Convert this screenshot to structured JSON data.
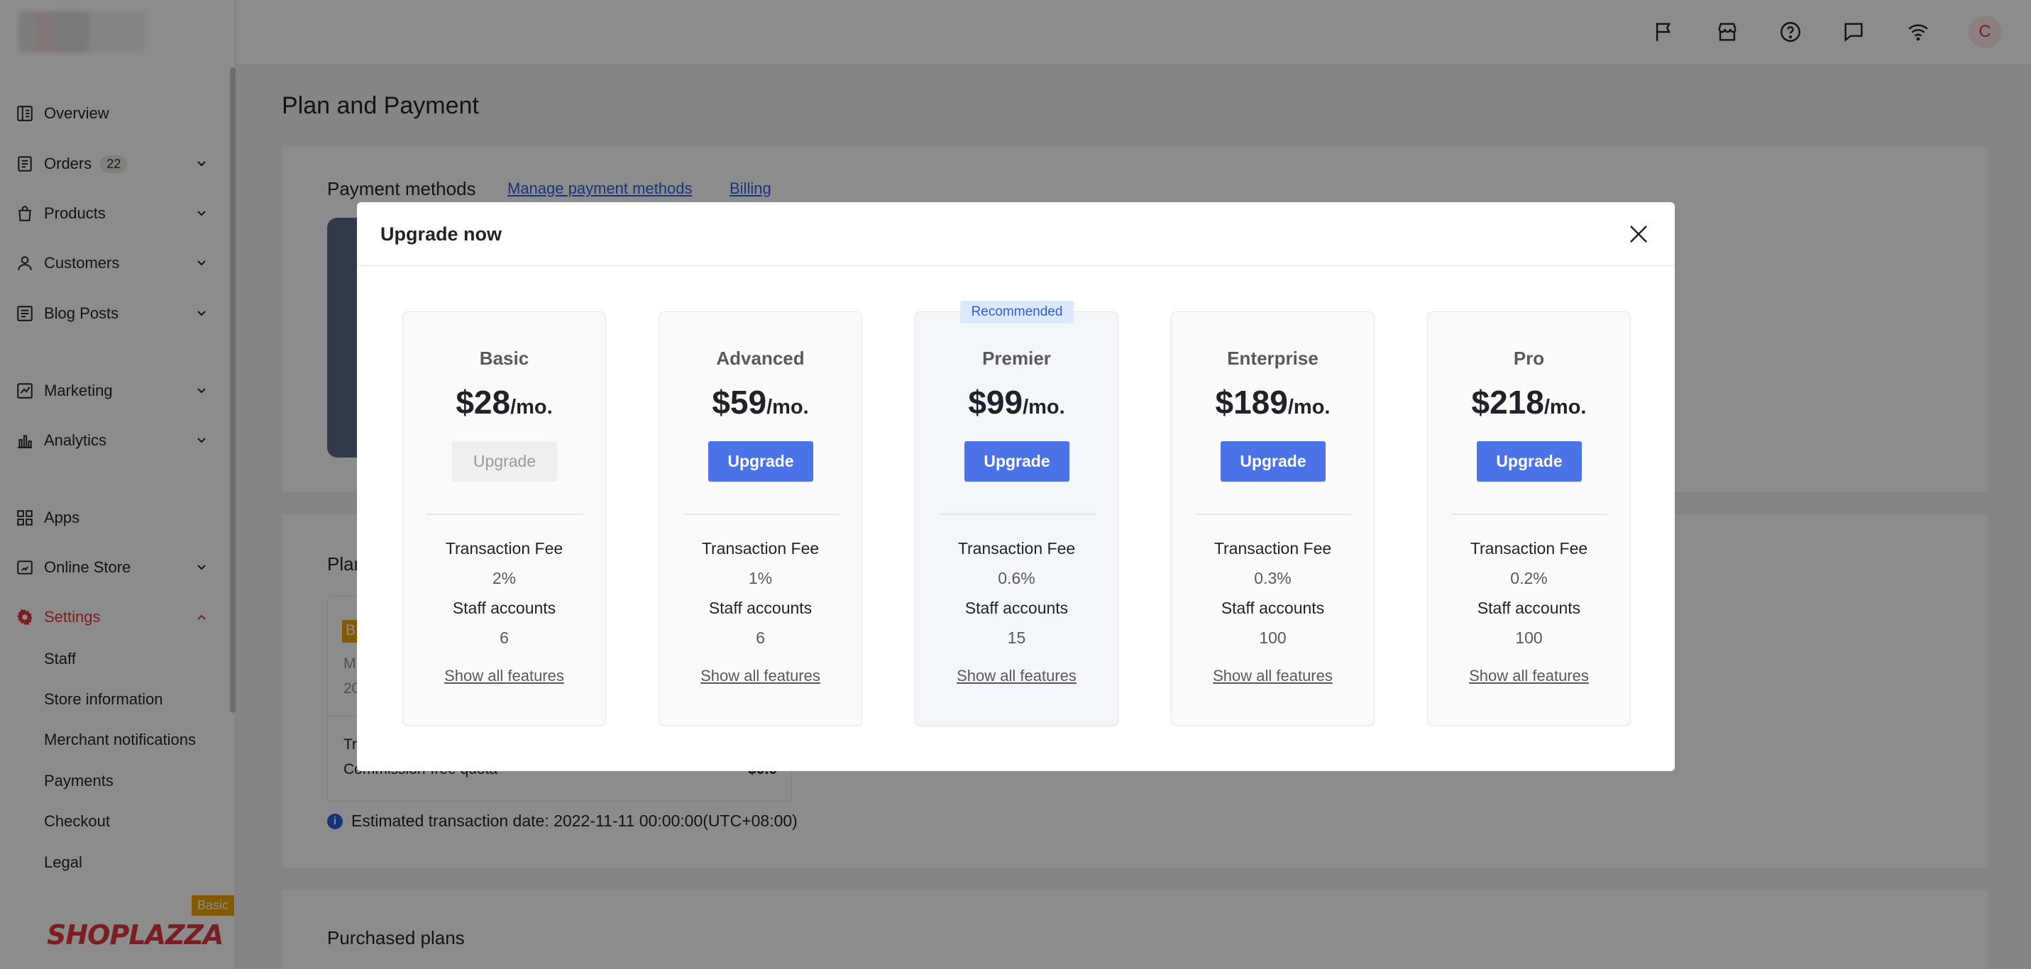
{
  "sidebar": {
    "items": [
      {
        "label": "Overview",
        "icon": "overview-icon"
      },
      {
        "label": "Orders",
        "icon": "orders-icon",
        "count": "22"
      },
      {
        "label": "Products",
        "icon": "products-icon"
      },
      {
        "label": "Customers",
        "icon": "customers-icon"
      },
      {
        "label": "Blog Posts",
        "icon": "blog-posts-icon"
      },
      {
        "label": "Marketing",
        "icon": "marketing-icon"
      },
      {
        "label": "Analytics",
        "icon": "analytics-icon"
      },
      {
        "label": "Apps",
        "icon": "apps-icon"
      },
      {
        "label": "Online Store",
        "icon": "online-store-icon"
      },
      {
        "label": "Settings",
        "icon": "settings-icon"
      }
    ],
    "settings_sub": [
      "Staff",
      "Store information",
      "Merchant notifications",
      "Payments",
      "Checkout",
      "Legal"
    ],
    "brand": "SHOPLAZZA",
    "plan_tag": "Basic",
    "active_color": "#e0383e"
  },
  "topbar": {
    "icons": [
      "flag-icon",
      "store-icon",
      "help-icon",
      "message-icon",
      "wifi-icon"
    ],
    "avatar_letter": "C"
  },
  "main": {
    "page_title": "Plan and Payment",
    "payment": {
      "title": "Payment methods",
      "manage_link": "Manage payment methods",
      "billing_link": "Billing"
    },
    "plan": {
      "title_partial": "Plan",
      "badge_partial": "B",
      "meta_partial_1": "M",
      "meta_partial_2": "20",
      "row_partial": "Tr",
      "commission_label": "Commission-free quota",
      "commission_value": "$0.0"
    },
    "estimated": "Estimated transaction date: 2022-11-11 00:00:00(UTC+08:00)",
    "purchased_title": "Purchased plans"
  },
  "modal": {
    "title": "Upgrade now",
    "recommended_label": "Recommended",
    "fee_label": "Transaction Fee",
    "staff_label": "Staff accounts",
    "show_all_label": "Show all features",
    "button_label": "Upgrade",
    "accent": "#4b72e6",
    "plans": [
      {
        "name": "Basic",
        "price": "$28",
        "period": "/mo.",
        "fee": "2%",
        "staff": "6",
        "disabled": true,
        "recommended": false
      },
      {
        "name": "Advanced",
        "price": "$59",
        "period": "/mo.",
        "fee": "1%",
        "staff": "6",
        "disabled": false,
        "recommended": false
      },
      {
        "name": "Premier",
        "price": "$99",
        "period": "/mo.",
        "fee": "0.6%",
        "staff": "15",
        "disabled": false,
        "recommended": true
      },
      {
        "name": "Enterprise",
        "price": "$189",
        "period": "/mo.",
        "fee": "0.3%",
        "staff": "100",
        "disabled": false,
        "recommended": false
      },
      {
        "name": "Pro",
        "price": "$218",
        "period": "/mo.",
        "fee": "0.2%",
        "staff": "100",
        "disabled": false,
        "recommended": false
      }
    ]
  }
}
